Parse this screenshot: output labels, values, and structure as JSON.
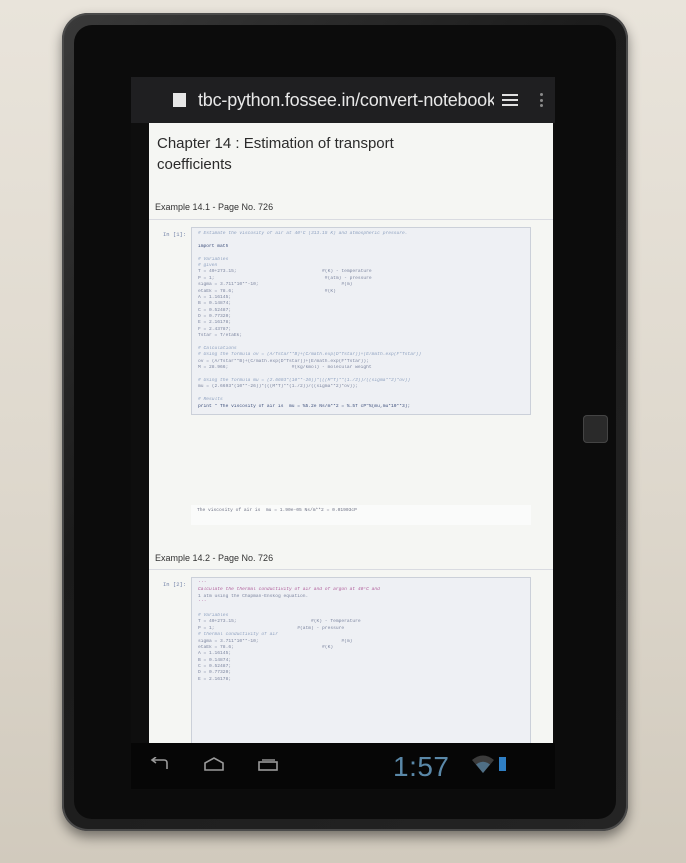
{
  "browser": {
    "url": "tbc-python.fossee.in/convert-notebook/р"
  },
  "page": {
    "chapter_title": "Chapter 14 : Estimation of transport coefficients",
    "examples": [
      {
        "heading": "Example 14.1 - Page No. 726",
        "prompt": "In [1]:",
        "code_lines": [
          "# Estimate the viscosity of air at 40°C (313.15 K) and atmospheric pressure.",
          "",
          "import math",
          "",
          "# Variables",
          "# given",
          "T = 40+273.15;                               #(K) - temperature",
          "P = 1;                                        #(atm) - pressure",
          "sigma = 3.711*10**-10;                              #(m)",
          "etaEk = 78.6;                                 #(K)",
          "A = 1.16145;",
          "B = 0.14874;",
          "C = 0.52487;",
          "D = 0.77320;",
          "E = 2.16178;",
          "F = 2.43787;",
          "Tstar = T/etaEk;",
          "",
          "# Calculations",
          "# Using the formula ov = (A/Tstar**B)+(C/math.exp(D*Tstar))+(E/math.exp(F*Tstar))",
          "ov = (A/Tstar**B)+(C/math.exp(D*Tstar))+(E/math.exp(F*Tstar));",
          "M = 28.966;                       #(kg/kmol) - molecular weight",
          "",
          "# Using the formula mu = (2.6693*(10**-26))*(((M*T)**(1./2))/((sigma**2)*ov))",
          "mu = (2.6693*(10**-26))*(((M*T)**(1./2))/((sigma**2)*ov));",
          "",
          "# Results",
          "print \" The viscosity of air is  mu = %5.2e Ns/m**2 = %.5f cP\"%(mu,mu*10**3);"
        ],
        "output_lines": [
          "The viscosity of air is  mu = 1.90e-05 Ns/m**2 = 0.01903",
          "cP"
        ]
      },
      {
        "heading": "Example 14.2 - Page No. 726",
        "prompt": "In [2]:",
        "code_lines": [
          "'''",
          "Calculate the thermal conductivity of air and of argon at 40°C and",
          "1 atm using the Chapman-Enskog equation.",
          "'''",
          "",
          "# Variables",
          "T = 40+273.15;                           #(K) - Temperature",
          "P = 1;                              #(atm) - pressure",
          "# thermal conductivity of air",
          "sigma = 3.711*10**-10;                              #(m)",
          "etaEk = 78.6;                                #(K)",
          "A = 1.16145;",
          "B = 0.14874;",
          "C = 0.52487;",
          "D = 0.77320;",
          "E = 2.16178;"
        ]
      }
    ]
  },
  "system_bar": {
    "time": "1:57"
  },
  "colors": {
    "clock": "#5a88a8",
    "battery": "#2f7fc5"
  }
}
